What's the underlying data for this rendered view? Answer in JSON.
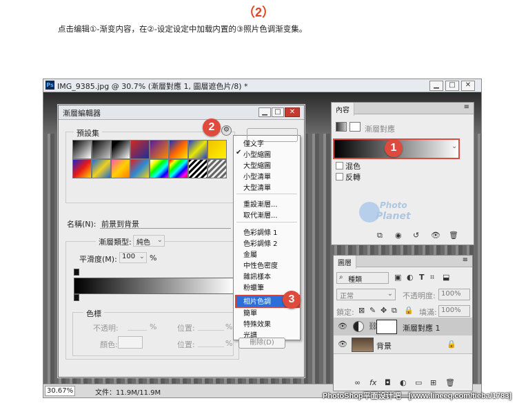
{
  "header": {
    "step": "（2）",
    "description": "点击编辑①-渐变内容，在②-设定设定中加载内置的③照片色调渐变集。"
  },
  "ps_window": {
    "title": "IMG_9385.jpg @ 30.7% (漸層對應 1, 圖層遮色片/8) *",
    "zoom": "30.67%",
    "doc_info": "文件：11.9M/11.9M",
    "logo": "Ps"
  },
  "gradient_editor": {
    "title": "漸層編輯器",
    "presets_label": "預設集",
    "name_label": "名稱(N):",
    "name_value": "前景到背景",
    "type_label": "漸層類型:",
    "type_value": "純色",
    "smooth_label": "平滑度(M):",
    "smooth_value": "100",
    "smooth_unit": "%",
    "stops_label": "色標",
    "opacity_label": "不透明:",
    "opacity_unit": "%",
    "color_label": "顏色:",
    "position_label": "位置:",
    "position_unit": "%",
    "position2_label": "位置:",
    "position2_unit": "%",
    "delete_button": "刪除(D)"
  },
  "menu": {
    "items": [
      {
        "label": "僅文字",
        "checked": false
      },
      {
        "label": "小型縮圖",
        "checked": true
      },
      {
        "label": "大型縮圖",
        "checked": false
      },
      {
        "label": "小型清單",
        "checked": false
      },
      {
        "label": "大型清單",
        "checked": false
      },
      {
        "label": "重設漸層...",
        "checked": false
      },
      {
        "label": "取代漸層...",
        "checked": false
      },
      {
        "label": "色彩調條 1",
        "checked": false
      },
      {
        "label": "色彩調條 2",
        "checked": false
      },
      {
        "label": "金屬",
        "checked": false
      },
      {
        "label": "中性色密度",
        "checked": false
      },
      {
        "label": "雜訊樣本",
        "checked": false
      },
      {
        "label": "粉蠟筆",
        "checked": false
      },
      {
        "label": "相片色調",
        "checked": false,
        "highlighted": true
      },
      {
        "label": "簡單",
        "checked": false
      },
      {
        "label": "特殊效果",
        "checked": false
      },
      {
        "label": "光譜",
        "checked": false
      }
    ]
  },
  "badges": {
    "b1": "1",
    "b2": "2",
    "b3": "3"
  },
  "properties": {
    "tab": "內容",
    "heading": "漸層對應",
    "dither_label": "混色",
    "reverse_label": "反轉",
    "logo_line1": "Photo",
    "logo_line2": "Planet"
  },
  "layers": {
    "tab": "圖層",
    "kind": "種類",
    "blend_mode": "正常",
    "opacity_label": "不透明度:",
    "opacity_value": "100%",
    "lock_label": "鎖定:",
    "fill_label": "填滿:",
    "fill_value": "100%",
    "rows": [
      {
        "name": "漸層對應 1"
      },
      {
        "name": "背景"
      }
    ]
  },
  "watermark": "PhotoShop平面设计吧—[www.lineeq.com/tieba/1783]",
  "colors": {
    "accent_red": "#e04a3c",
    "header_orange": "#e0451f",
    "highlight_blue": "#2d6fd6"
  }
}
